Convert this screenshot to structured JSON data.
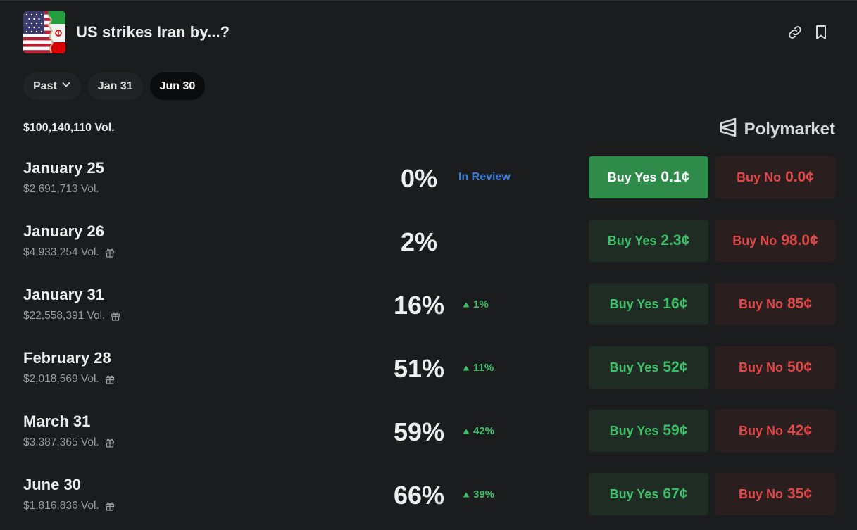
{
  "header": {
    "title": "US strikes Iran by...?",
    "link_icon": "link-icon",
    "bookmark_icon": "bookmark-icon"
  },
  "filters": [
    {
      "label": "Past",
      "has_dropdown": true,
      "active": false
    },
    {
      "label": "Jan 31",
      "active": false
    },
    {
      "label": "Jun 30",
      "active": true
    }
  ],
  "market": {
    "total_volume": "$100,140,110 Vol.",
    "brand": "Polymarket"
  },
  "labels": {
    "buy_yes": "Buy Yes",
    "buy_no": "Buy No"
  },
  "colors": {
    "yes": "#3fbf6a",
    "no": "#e04848",
    "review": "#3a7fd8",
    "background": "#1b1c1e"
  },
  "outcomes": [
    {
      "date": "January 25",
      "volume": "$2,691,713 Vol.",
      "gift": false,
      "probability": "0%",
      "change": "",
      "status": "In Review",
      "yes_price": "0.1¢",
      "no_price": "0.0¢",
      "yes_highlighted": true
    },
    {
      "date": "January 26",
      "volume": "$4,933,254 Vol.",
      "gift": true,
      "probability": "2%",
      "change": "",
      "status": "",
      "yes_price": "2.3¢",
      "no_price": "98.0¢",
      "yes_highlighted": false
    },
    {
      "date": "January 31",
      "volume": "$22,558,391 Vol.",
      "gift": true,
      "probability": "16%",
      "change": "1%",
      "status": "",
      "yes_price": "16¢",
      "no_price": "85¢",
      "yes_highlighted": false
    },
    {
      "date": "February 28",
      "volume": "$2,018,569 Vol.",
      "gift": true,
      "probability": "51%",
      "change": "11%",
      "status": "",
      "yes_price": "52¢",
      "no_price": "50¢",
      "yes_highlighted": false
    },
    {
      "date": "March 31",
      "volume": "$3,387,365 Vol.",
      "gift": true,
      "probability": "59%",
      "change": "42%",
      "status": "",
      "yes_price": "59¢",
      "no_price": "42¢",
      "yes_highlighted": false
    },
    {
      "date": "June 30",
      "volume": "$1,816,836 Vol.",
      "gift": true,
      "probability": "66%",
      "change": "39%",
      "status": "",
      "yes_price": "67¢",
      "no_price": "35¢",
      "yes_highlighted": false
    }
  ]
}
